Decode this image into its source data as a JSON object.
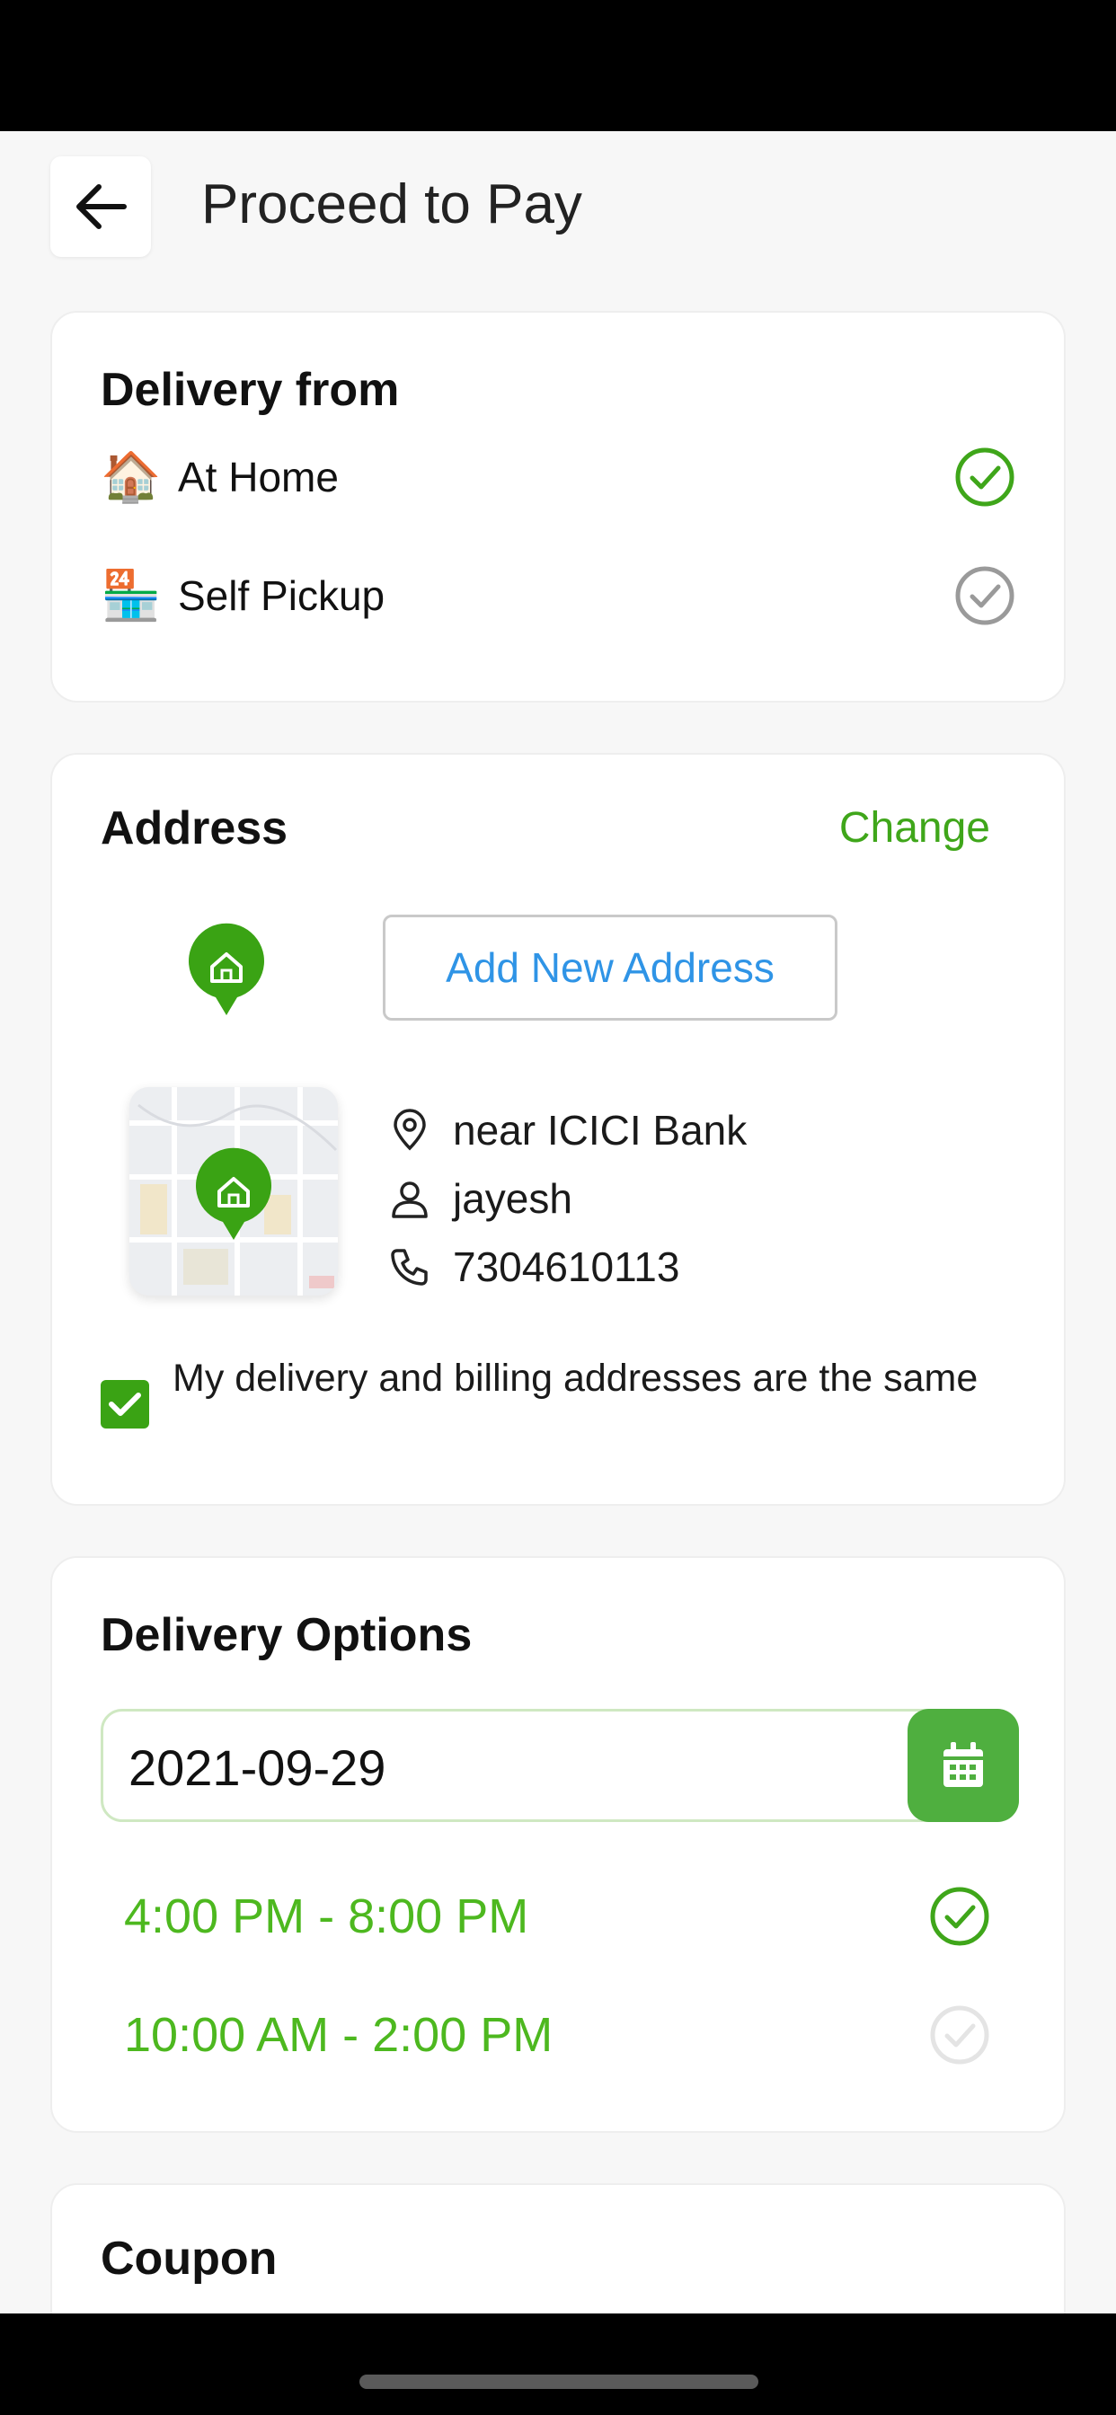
{
  "header": {
    "title": "Proceed to Pay"
  },
  "delivery_from": {
    "title": "Delivery from",
    "options": [
      {
        "label": "At Home",
        "icon": "house-emoji",
        "selected": true
      },
      {
        "label": "Self Pickup",
        "icon": "store-emoji",
        "selected": false
      }
    ]
  },
  "address": {
    "title": "Address",
    "change_label": "Change",
    "add_new_label": "Add New Address",
    "location": "near ICICI Bank",
    "name": "jayesh",
    "phone": "7304610113",
    "billing_same_label": "My delivery and billing addresses are the same",
    "billing_same_checked": true
  },
  "delivery_options": {
    "title": "Delivery Options",
    "date": "2021-09-29",
    "slots": [
      {
        "label": "4:00 PM - 8:00 PM",
        "selected": true
      },
      {
        "label": "10:00 AM - 2:00 PM",
        "selected": false
      }
    ]
  },
  "coupon": {
    "title": "Coupon"
  },
  "colors": {
    "accent_green": "#3fa61a",
    "link_blue": "#2f94e6",
    "slot_green": "#4db81f",
    "unchecked_gray": "#9a9a9a"
  }
}
